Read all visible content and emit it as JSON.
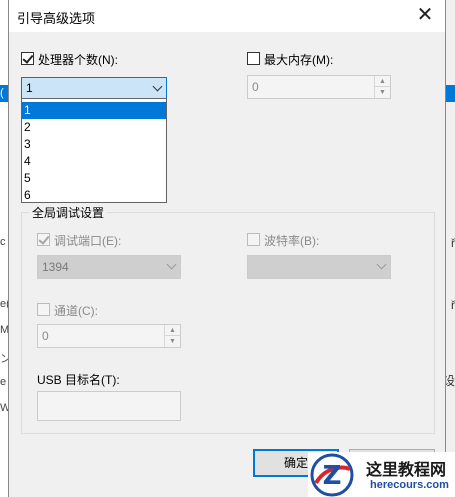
{
  "dialog": {
    "title": "引导高级选项"
  },
  "processor": {
    "label": "处理器个数(N):",
    "checked": true,
    "selected": "1",
    "options": [
      "1",
      "2",
      "3",
      "4",
      "5",
      "6"
    ]
  },
  "memory": {
    "label": "最大内存(M):",
    "checked": false,
    "value": "0"
  },
  "debug_group": {
    "title": "全局调试设置",
    "port_label": "调试端口(E):",
    "port_value": "1394",
    "baud_label": "波特率(B):",
    "baud_value": "",
    "channel_label": "通道(C):",
    "channel_value": "0",
    "usb_label": "USB 目标名(T):",
    "usb_value": ""
  },
  "buttons": {
    "ok": "确定"
  },
  "background_left": [
    "(",
    "c",
    "o",
    "e(",
    "M",
    "ン",
    "e",
    "W"
  ],
  "background_right": [
    "ř",
    "ř",
    "ř",
    "设"
  ],
  "watermark": {
    "name": "这里教程网",
    "url": "herecours.com"
  },
  "colors": {
    "accent": "#0078d7",
    "selection_text": "#ffffff",
    "focus_fill": "#cce4f7"
  }
}
